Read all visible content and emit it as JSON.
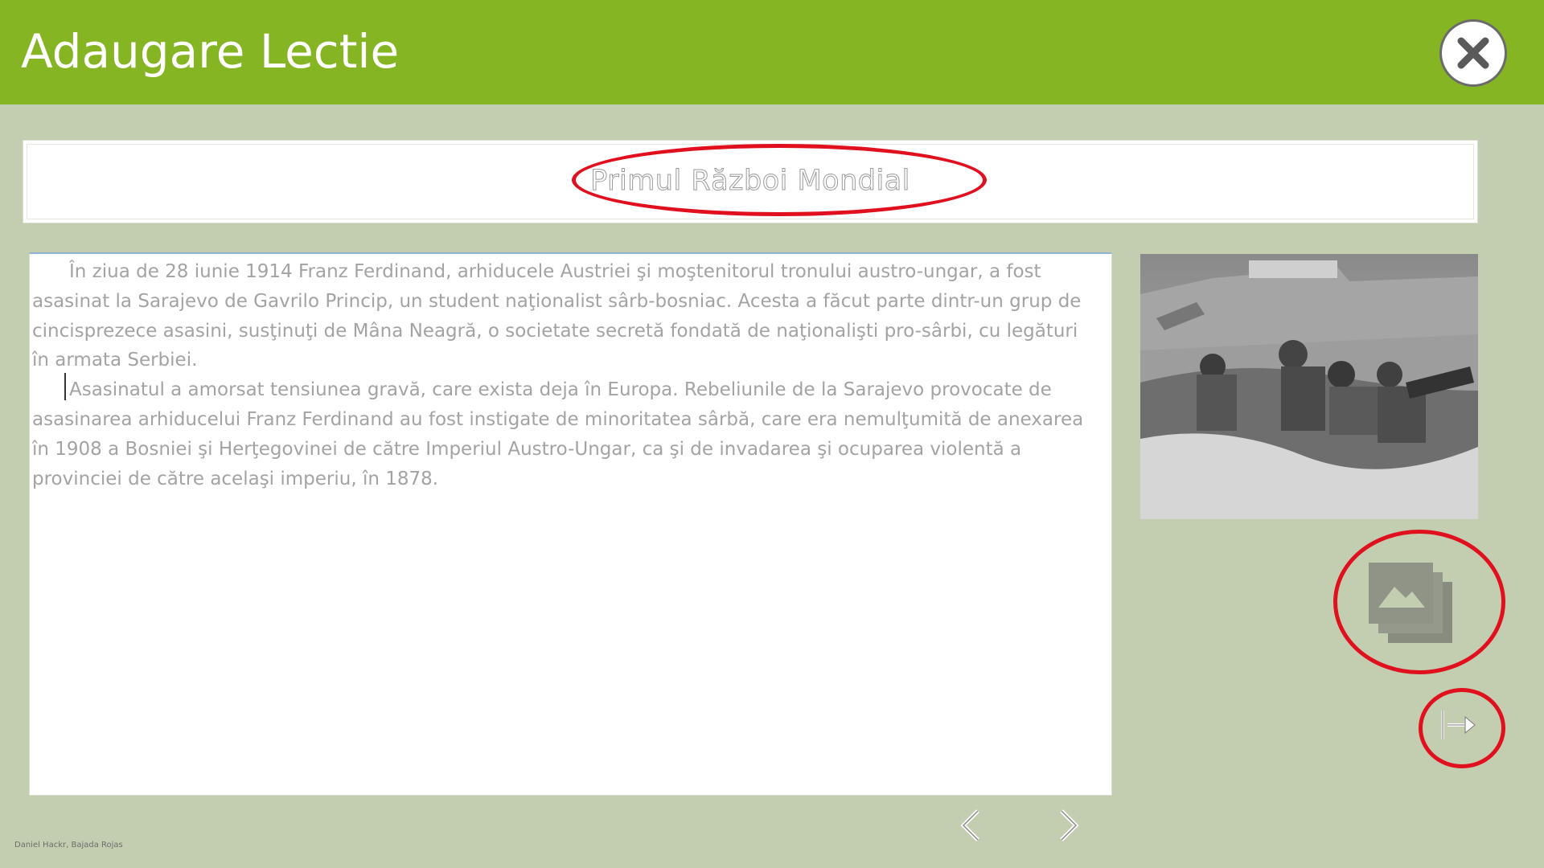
{
  "header": {
    "title": "Adaugare Lectie",
    "close_icon": "close-icon"
  },
  "lesson": {
    "title": "Primul Război Mondial",
    "paragraphs": [
      "În ziua de 28 iunie 1914 Franz Ferdinand, arhiducele Austriei şi moştenitorul tronului austro-ungar, a fost asasinat la Sarajevo de Gavrilo Princip, un student naţionalist sârb-bosniac. Acesta a făcut parte dintr-un grup de cincisprezece asasini, susţinuţi de Mâna Neagră, o societate secretă fondată de naţionalişti pro-sârbi, cu legături în armata Serbiei.",
      "Asasinatul a amorsat tensiunea gravă, care exista deja în Europa. Rebeliunile de la Sarajevo provocate de asasinarea arhiducelui Franz Ferdinand au fost instigate de minoritatea sârbă, care era nemulţumită de anexarea în 1908 a Bosniei şi Herţegovinei de către Imperiul Austro-Ungar, ca şi de invadarea şi ocuparea violentă a provinciei de către acelaşi imperiu, în 1878."
    ]
  },
  "image": {
    "description_icon": "photo"
  },
  "actions": {
    "gallery_icon": "image-gallery-icon",
    "exit_icon": "exit-arrow-icon",
    "prev_icon": "chevron-left-icon",
    "next_icon": "chevron-right-icon"
  },
  "footer": {
    "text": "Daniel Hackr, Bajada Rojas"
  },
  "colors": {
    "header_bg": "#86b524",
    "page_bg": "#c3cdb0",
    "annotation_red": "#e0101e"
  }
}
